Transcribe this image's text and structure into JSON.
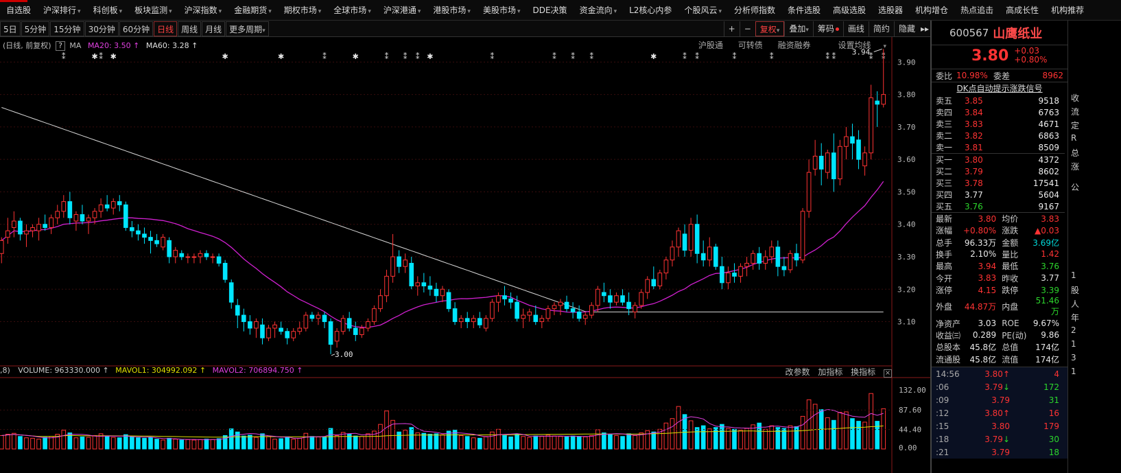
{
  "nav": {
    "items": [
      "自选股",
      "沪深排行",
      "科创板",
      "板块监测",
      "沪深指数",
      "金融期货",
      "期权市场",
      "全球市场",
      "沪深港通",
      "港股市场",
      "美股市场",
      "DDE决策",
      "资金流向",
      "L2核心内参",
      "个股风云",
      "分析师指数",
      "条件选股",
      "高级选股",
      "选股器",
      "机构增仓",
      "热点追击",
      "高成长性",
      "机构推荐"
    ],
    "dropdowns": [
      false,
      true,
      true,
      true,
      true,
      true,
      true,
      true,
      true,
      true,
      true,
      false,
      true,
      false,
      true,
      false,
      false,
      false,
      false,
      false,
      false,
      false,
      false
    ]
  },
  "periods": {
    "items": [
      "5日",
      "5分钟",
      "15分钟",
      "30分钟",
      "60分钟",
      "日线",
      "周线",
      "月线",
      "更多周期"
    ],
    "active": "日线"
  },
  "toolbar": {
    "plus": "+",
    "minus": "−",
    "fuquan": "复权",
    "overlay": "叠加",
    "chouma": "筹码",
    "drawline": "画线",
    "simple": "简约",
    "hide": "隐藏",
    "more": "▸▸",
    "toggle": "▾"
  },
  "ma_line": {
    "prefix": "(日线, 前复权)",
    "q": "?",
    "ma": "MA",
    "ma20": "MA20: 3.50",
    "ma60": "MA60: 3.28"
  },
  "links": [
    "沪股通",
    "可转债",
    "融资融券",
    "设置均线"
  ],
  "price_axis": [
    "3.90",
    "3.80",
    "3.70",
    "3.60",
    "3.50",
    "3.40",
    "3.30",
    "3.20",
    "3.10"
  ],
  "annotations": {
    "high": "3.94",
    "low": "3.00"
  },
  "volume": {
    "prefix": ",8)",
    "vol": "VOLUME: 963330.000",
    "mavol1": "MAVOL1: 304992.092",
    "mavol2": "MAVOL2: 706894.750",
    "axis": [
      "132.00",
      "87.60",
      "44.40",
      "0.00"
    ],
    "buttons": [
      "改参数",
      "加指标",
      "换指标"
    ],
    "close": "×"
  },
  "stock": {
    "code": "600567",
    "name": "山鹰纸业",
    "price": "3.80",
    "change": "+0.03",
    "pct": "+0.80%"
  },
  "weibi": {
    "label1": "委比",
    "v1": "10.98%",
    "label2": "委差",
    "v2": "8962"
  },
  "signal": "DK点自动提示涨跌信号",
  "orderbook": {
    "sells": [
      {
        "l": "卖五",
        "p": "3.85",
        "v": "9518"
      },
      {
        "l": "卖四",
        "p": "3.84",
        "v": "6763"
      },
      {
        "l": "卖三",
        "p": "3.83",
        "v": "4671"
      },
      {
        "l": "卖二",
        "p": "3.82",
        "v": "6863"
      },
      {
        "l": "卖一",
        "p": "3.81",
        "v": "8509"
      }
    ],
    "buys": [
      {
        "l": "买一",
        "p": "3.80",
        "v": "4372"
      },
      {
        "l": "买二",
        "p": "3.79",
        "v": "8602"
      },
      {
        "l": "买三",
        "p": "3.78",
        "v": "17541"
      },
      {
        "l": "买四",
        "p": "3.77",
        "v": "5604"
      },
      {
        "l": "买五",
        "p": "3.76",
        "v": "9167"
      }
    ]
  },
  "stats": [
    {
      "a": "最新",
      "av": "3.80",
      "ac": "red",
      "b": "均价",
      "bv": "3.83",
      "bc": "red"
    },
    {
      "a": "涨幅",
      "av": "+0.80%",
      "ac": "red",
      "b": "涨跌",
      "bv": "▲0.03",
      "bc": "red"
    },
    {
      "a": "总手",
      "av": "96.33万",
      "ac": "white",
      "b": "金额",
      "bv": "3.69亿",
      "bc": "cyan"
    },
    {
      "a": "换手",
      "av": "2.10%",
      "ac": "white",
      "b": "量比",
      "bv": "1.42",
      "bc": "red"
    },
    {
      "a": "最高",
      "av": "3.94",
      "ac": "red",
      "b": "最低",
      "bv": "3.76",
      "bc": "green"
    },
    {
      "a": "今开",
      "av": "3.83",
      "ac": "red",
      "b": "昨收",
      "bv": "3.77",
      "bc": "white"
    },
    {
      "a": "涨停",
      "av": "4.15",
      "ac": "red",
      "b": "跌停",
      "bv": "3.39",
      "bc": "green"
    },
    {
      "a": "外盘",
      "av": "44.87万",
      "ac": "red",
      "b": "内盘",
      "bv": "51.46万",
      "bc": "green"
    },
    {
      "a": "净资产",
      "av": "3.03",
      "ac": "white",
      "b": "ROE",
      "bv": "9.67%",
      "bc": "white"
    },
    {
      "a": "收益㈢",
      "av": "0.289",
      "ac": "white",
      "b": "PE(动)",
      "bv": "9.86",
      "bc": "white"
    },
    {
      "a": "总股本",
      "av": "45.8亿",
      "ac": "white",
      "b": "总值",
      "bv": "174亿",
      "bc": "white"
    },
    {
      "a": "流通股",
      "av": "45.8亿",
      "ac": "white",
      "b": "流值",
      "bv": "174亿",
      "bc": "white"
    }
  ],
  "ticks": [
    {
      "t": "14:56",
      "p": "3.80",
      "arrow": "↑",
      "ac": "red",
      "v": "4",
      "vc": "red"
    },
    {
      "t": ":06",
      "p": "3.79",
      "arrow": "↓",
      "ac": "green",
      "v": "172",
      "vc": "green"
    },
    {
      "t": ":09",
      "p": "3.79",
      "arrow": "",
      "ac": "",
      "v": "31",
      "vc": "green"
    },
    {
      "t": ":12",
      "p": "3.80",
      "arrow": "↑",
      "ac": "red",
      "v": "16",
      "vc": "red"
    },
    {
      "t": ":15",
      "p": "3.80",
      "arrow": "",
      "ac": "",
      "v": "179",
      "vc": "red"
    },
    {
      "t": ":18",
      "p": "3.79",
      "arrow": "↓",
      "ac": "green",
      "v": "30",
      "vc": "green"
    },
    {
      "t": ":21",
      "p": "3.79",
      "arrow": "",
      "ac": "",
      "v": "18",
      "vc": "green"
    }
  ],
  "farright": [
    "收",
    "流",
    "定",
    "R",
    "总",
    "涨",
    "公",
    "1",
    "股",
    "人",
    "年",
    "2",
    "1",
    "3",
    "1"
  ],
  "colors": {
    "up": "#ff3333",
    "down": "#00e5ff",
    "ma20": "#d020d0",
    "ma60": "#d8d8d8",
    "mavol1": "#e0e000",
    "mavol2": "#e040e0"
  },
  "chart_data": {
    "type": "candlestick",
    "ylim": [
      2.97,
      3.96
    ],
    "candles": [
      [
        3.31,
        3.36,
        3.28,
        3.35
      ],
      [
        3.36,
        3.42,
        3.34,
        3.38
      ],
      [
        3.39,
        3.44,
        3.36,
        3.41
      ],
      [
        3.41,
        3.42,
        3.35,
        3.37
      ],
      [
        3.37,
        3.4,
        3.33,
        3.38
      ],
      [
        3.38,
        3.4,
        3.36,
        3.39
      ],
      [
        3.38,
        3.42,
        3.35,
        3.4
      ],
      [
        3.4,
        3.43,
        3.38,
        3.39
      ],
      [
        3.39,
        3.43,
        3.37,
        3.42
      ],
      [
        3.42,
        3.46,
        3.4,
        3.44
      ],
      [
        3.44,
        3.49,
        3.42,
        3.47
      ],
      [
        3.47,
        3.5,
        3.4,
        3.42
      ],
      [
        3.41,
        3.44,
        3.38,
        3.43
      ],
      [
        3.43,
        3.46,
        3.4,
        3.41
      ],
      [
        3.41,
        3.43,
        3.37,
        3.42
      ],
      [
        3.42,
        3.45,
        3.4,
        3.44
      ],
      [
        3.44,
        3.48,
        3.42,
        3.46
      ],
      [
        3.46,
        3.49,
        3.44,
        3.45
      ],
      [
        3.45,
        3.48,
        3.43,
        3.47
      ],
      [
        3.47,
        3.49,
        3.44,
        3.46
      ],
      [
        3.46,
        3.47,
        3.38,
        3.39
      ],
      [
        3.39,
        3.41,
        3.36,
        3.38
      ],
      [
        3.38,
        3.4,
        3.35,
        3.37
      ],
      [
        3.37,
        3.39,
        3.34,
        3.36
      ],
      [
        3.36,
        3.38,
        3.31,
        3.35
      ],
      [
        3.35,
        3.37,
        3.33,
        3.34
      ],
      [
        3.33,
        3.37,
        3.32,
        3.36
      ],
      [
        3.35,
        3.36,
        3.28,
        3.3
      ],
      [
        3.3,
        3.33,
        3.28,
        3.32
      ],
      [
        3.31,
        3.32,
        3.29,
        3.3
      ],
      [
        3.3,
        3.31,
        3.28,
        3.3
      ],
      [
        3.3,
        3.31,
        3.28,
        3.3
      ],
      [
        3.3,
        3.32,
        3.28,
        3.31
      ],
      [
        3.31,
        3.32,
        3.29,
        3.3
      ],
      [
        3.3,
        3.31,
        3.28,
        3.3
      ],
      [
        3.3,
        3.31,
        3.27,
        3.28
      ],
      [
        3.28,
        3.29,
        3.22,
        3.23
      ],
      [
        3.22,
        3.23,
        3.14,
        3.16
      ],
      [
        3.15,
        3.17,
        3.08,
        3.12
      ],
      [
        3.12,
        3.14,
        3.07,
        3.1
      ],
      [
        3.1,
        3.12,
        3.06,
        3.08
      ],
      [
        3.08,
        3.11,
        3.05,
        3.1
      ],
      [
        3.09,
        3.11,
        3.03,
        3.05
      ],
      [
        3.05,
        3.09,
        3.04,
        3.08
      ],
      [
        3.08,
        3.1,
        3.05,
        3.09
      ],
      [
        3.08,
        3.1,
        3.06,
        3.07
      ],
      [
        3.07,
        3.08,
        3.03,
        3.05
      ],
      [
        3.05,
        3.08,
        3.04,
        3.07
      ],
      [
        3.07,
        3.1,
        3.06,
        3.08
      ],
      [
        3.08,
        3.13,
        3.07,
        3.12
      ],
      [
        3.12,
        3.13,
        3.1,
        3.11
      ],
      [
        3.11,
        3.13,
        3.09,
        3.12
      ],
      [
        3.12,
        3.13,
        3.08,
        3.1
      ],
      [
        3.1,
        3.11,
        3.0,
        3.03
      ],
      [
        3.04,
        3.08,
        3.02,
        3.07
      ],
      [
        3.07,
        3.12,
        3.06,
        3.11
      ],
      [
        3.11,
        3.13,
        3.07,
        3.08
      ],
      [
        3.08,
        3.1,
        3.04,
        3.06
      ],
      [
        3.06,
        3.09,
        3.05,
        3.08
      ],
      [
        3.08,
        3.11,
        3.07,
        3.1
      ],
      [
        3.1,
        3.15,
        3.09,
        3.14
      ],
      [
        3.14,
        3.2,
        3.13,
        3.18
      ],
      [
        3.18,
        3.26,
        3.16,
        3.24
      ],
      [
        3.24,
        3.37,
        3.22,
        3.3
      ],
      [
        3.3,
        3.32,
        3.25,
        3.27
      ],
      [
        3.27,
        3.31,
        3.25,
        3.29
      ],
      [
        3.28,
        3.3,
        3.2,
        3.21
      ],
      [
        3.21,
        3.24,
        3.18,
        3.22
      ],
      [
        3.22,
        3.25,
        3.19,
        3.21
      ],
      [
        3.21,
        3.24,
        3.18,
        3.2
      ],
      [
        3.2,
        3.22,
        3.16,
        3.18
      ],
      [
        3.18,
        3.21,
        3.16,
        3.2
      ],
      [
        3.19,
        3.2,
        3.13,
        3.14
      ],
      [
        3.14,
        3.16,
        3.09,
        3.1
      ],
      [
        3.1,
        3.12,
        3.08,
        3.11
      ],
      [
        3.11,
        3.13,
        3.08,
        3.1
      ],
      [
        3.1,
        3.12,
        3.08,
        3.11
      ],
      [
        3.11,
        3.13,
        3.08,
        3.09
      ],
      [
        3.08,
        3.12,
        3.07,
        3.11
      ],
      [
        3.11,
        3.17,
        3.1,
        3.16
      ],
      [
        3.16,
        3.19,
        3.13,
        3.18
      ],
      [
        3.18,
        3.21,
        3.15,
        3.17
      ],
      [
        3.17,
        3.19,
        3.14,
        3.16
      ],
      [
        3.16,
        3.18,
        3.1,
        3.11
      ],
      [
        3.11,
        3.14,
        3.08,
        3.12
      ],
      [
        3.12,
        3.14,
        3.1,
        3.13
      ],
      [
        3.12,
        3.15,
        3.09,
        3.1
      ],
      [
        3.1,
        3.12,
        3.08,
        3.11
      ],
      [
        3.11,
        3.15,
        3.1,
        3.14
      ],
      [
        3.14,
        3.16,
        3.12,
        3.15
      ],
      [
        3.15,
        3.17,
        3.12,
        3.16
      ],
      [
        3.16,
        3.18,
        3.13,
        3.14
      ],
      [
        3.14,
        3.16,
        3.11,
        3.13
      ],
      [
        3.13,
        3.15,
        3.1,
        3.11
      ],
      [
        3.11,
        3.13,
        3.09,
        3.12
      ],
      [
        3.12,
        3.16,
        3.11,
        3.15
      ],
      [
        3.15,
        3.21,
        3.13,
        3.2
      ],
      [
        3.19,
        3.22,
        3.16,
        3.18
      ],
      [
        3.18,
        3.2,
        3.14,
        3.16
      ],
      [
        3.16,
        3.19,
        3.15,
        3.18
      ],
      [
        3.18,
        3.2,
        3.15,
        3.16
      ],
      [
        3.16,
        3.19,
        3.12,
        3.14
      ],
      [
        3.13,
        3.16,
        3.11,
        3.15
      ],
      [
        3.15,
        3.2,
        3.14,
        3.19
      ],
      [
        3.19,
        3.24,
        3.17,
        3.23
      ],
      [
        3.23,
        3.27,
        3.2,
        3.21
      ],
      [
        3.21,
        3.26,
        3.2,
        3.25
      ],
      [
        3.25,
        3.3,
        3.23,
        3.29
      ],
      [
        3.29,
        3.35,
        3.27,
        3.33
      ],
      [
        3.33,
        3.39,
        3.3,
        3.38
      ],
      [
        3.37,
        3.4,
        3.3,
        3.32
      ],
      [
        3.32,
        3.42,
        3.3,
        3.4
      ],
      [
        3.4,
        3.43,
        3.28,
        3.31
      ],
      [
        3.31,
        3.35,
        3.27,
        3.29
      ],
      [
        3.29,
        3.36,
        3.27,
        3.33
      ],
      [
        3.33,
        3.34,
        3.26,
        3.27
      ],
      [
        3.27,
        3.3,
        3.2,
        3.22
      ],
      [
        3.22,
        3.27,
        3.2,
        3.25
      ],
      [
        3.25,
        3.28,
        3.22,
        3.24
      ],
      [
        3.24,
        3.28,
        3.22,
        3.27
      ],
      [
        3.27,
        3.3,
        3.24,
        3.28
      ],
      [
        3.28,
        3.32,
        3.26,
        3.31
      ],
      [
        3.31,
        3.33,
        3.26,
        3.28
      ],
      [
        3.28,
        3.32,
        3.26,
        3.3
      ],
      [
        3.3,
        3.35,
        3.28,
        3.33
      ],
      [
        3.33,
        3.35,
        3.24,
        3.27
      ],
      [
        3.27,
        3.3,
        3.24,
        3.26
      ],
      [
        3.26,
        3.32,
        3.25,
        3.31
      ],
      [
        3.31,
        3.34,
        3.27,
        3.29
      ],
      [
        3.29,
        3.45,
        3.28,
        3.44
      ],
      [
        3.44,
        3.6,
        3.42,
        3.56
      ],
      [
        3.57,
        3.66,
        3.55,
        3.61
      ],
      [
        3.61,
        3.65,
        3.52,
        3.57
      ],
      [
        3.56,
        3.63,
        3.54,
        3.62
      ],
      [
        3.62,
        3.68,
        3.5,
        3.54
      ],
      [
        3.54,
        3.66,
        3.52,
        3.64
      ],
      [
        3.64,
        3.7,
        3.6,
        3.67
      ],
      [
        3.67,
        3.71,
        3.6,
        3.65
      ],
      [
        3.66,
        3.69,
        3.57,
        3.6
      ],
      [
        3.58,
        3.64,
        3.55,
        3.62
      ],
      [
        3.62,
        3.83,
        3.6,
        3.79
      ],
      [
        3.78,
        3.81,
        3.7,
        3.77
      ],
      [
        3.77,
        3.94,
        3.76,
        3.8
      ]
    ],
    "volumes": [
      30,
      33,
      35,
      28,
      25,
      24,
      22,
      26,
      28,
      33,
      42,
      36,
      25,
      27,
      26,
      30,
      34,
      28,
      26,
      25,
      32,
      27,
      25,
      24,
      26,
      22,
      20,
      24,
      22,
      20,
      21,
      20,
      21,
      22,
      21,
      23,
      30,
      45,
      38,
      29,
      31,
      26,
      34,
      28,
      22,
      23,
      27,
      22,
      24,
      35,
      28,
      27,
      26,
      46,
      30,
      37,
      33,
      29,
      28,
      34,
      40,
      55,
      85,
      64,
      38,
      42,
      48,
      36,
      35,
      33,
      34,
      32,
      40,
      42,
      30,
      28,
      25,
      24,
      28,
      38,
      44,
      30,
      27,
      33,
      28,
      26,
      29,
      28,
      31,
      29,
      28,
      27,
      29,
      28,
      27,
      30,
      43,
      36,
      32,
      30,
      28,
      34,
      30,
      36,
      41,
      38,
      44,
      58,
      68,
      95,
      77,
      63,
      48,
      52,
      45,
      48,
      55,
      46,
      44,
      42,
      46,
      54,
      58,
      44,
      52,
      48,
      46,
      52,
      50,
      73,
      110,
      100,
      88,
      70,
      64,
      82,
      83,
      68,
      62,
      60,
      124,
      62,
      90
    ]
  }
}
